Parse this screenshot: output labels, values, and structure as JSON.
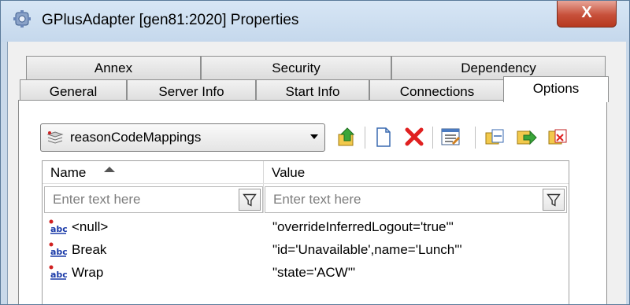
{
  "window": {
    "title": "GPlusAdapter [gen81:2020] Properties",
    "close_label": "X"
  },
  "tabs": {
    "row_back": [
      "Annex",
      "Security",
      "Dependency"
    ],
    "row_front": [
      "General",
      "Server Info",
      "Start Info",
      "Connections",
      "Options"
    ],
    "active": "Options"
  },
  "section_selector": {
    "selected": "reasonCodeMappings"
  },
  "toolbar": {
    "icons": [
      "upload-icon",
      "new-document-icon",
      "delete-icon",
      "edit-list-icon",
      "copy-icon",
      "export-icon",
      "import-icon"
    ]
  },
  "grid": {
    "columns": [
      "Name",
      "Value"
    ],
    "sorted_column": "Name",
    "filter_placeholder": "Enter text here",
    "rows": [
      {
        "name": "<null>",
        "value": "\"overrideInferredLogout='true'\""
      },
      {
        "name": "Break",
        "value": "\"id='Unavailable',name='Lunch'\""
      },
      {
        "name": "Wrap",
        "value": "\"state='ACW'\""
      }
    ]
  },
  "colors": {
    "titlebar": "#c9d9ea",
    "close_button": "#c7503a",
    "accent_red": "#e02020",
    "abc_icon_blue": "#1a3aa8"
  }
}
